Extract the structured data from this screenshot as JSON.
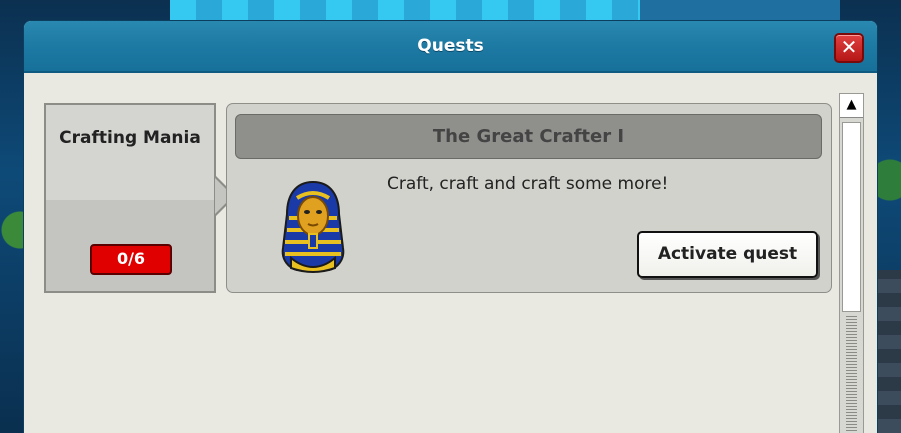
{
  "window": {
    "title": "Quests",
    "close_symbol": "✕"
  },
  "category": {
    "name": "Crafting Mania",
    "progress": "0/6"
  },
  "quest": {
    "title": "The Great Crafter I",
    "description": "Craft, craft and craft some more!",
    "icon": "pharaoh-head-icon",
    "activate_label": "Activate quest"
  },
  "scrollbar": {
    "up_symbol": "▲"
  },
  "colors": {
    "titlebar": "#1d7aa3",
    "progress_badge": "#e00000",
    "close_button": "#c41f1f"
  }
}
